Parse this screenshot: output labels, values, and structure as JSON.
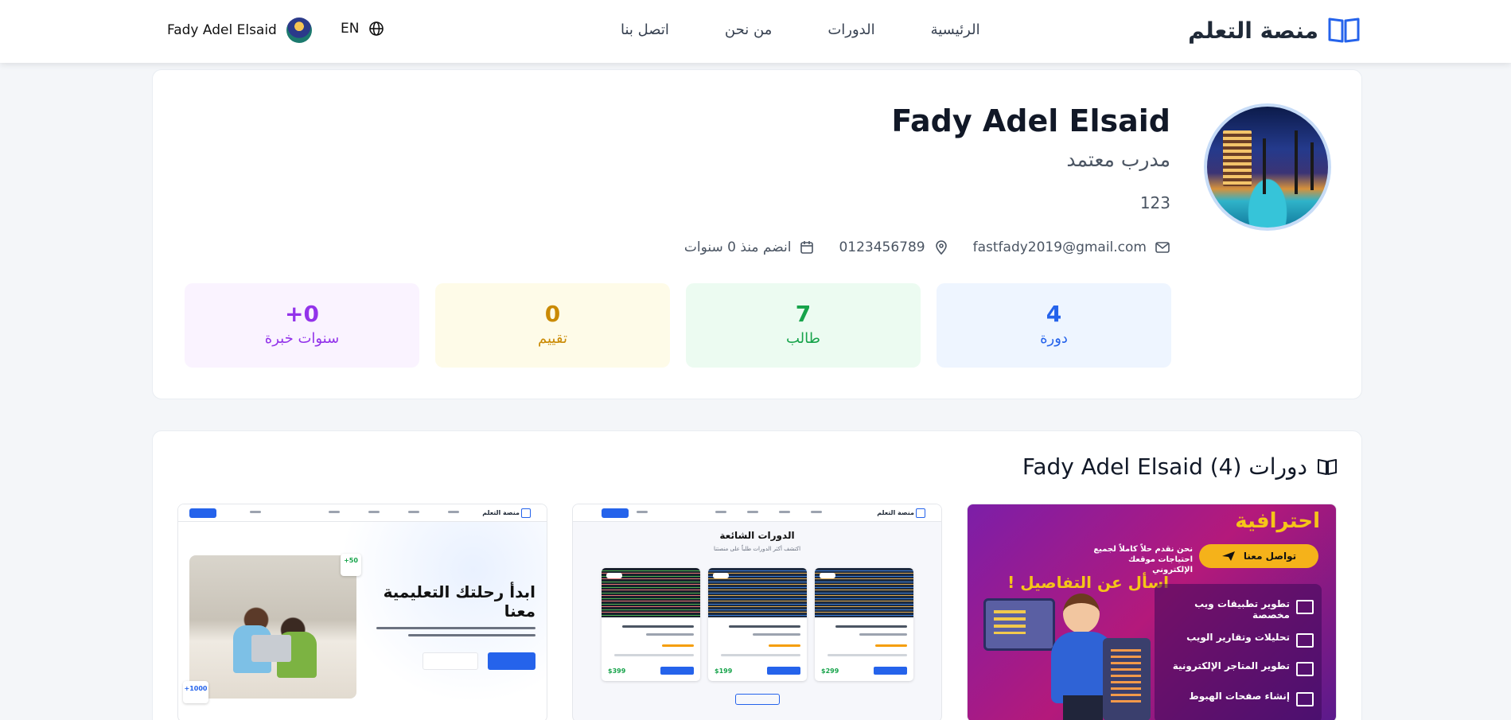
{
  "navbar": {
    "brand": "منصة التعلم",
    "links": [
      "الرئيسية",
      "الدورات",
      "من نحن",
      "اتصل بنا"
    ],
    "language": "EN",
    "user_name": "Fady Adel Elsaid"
  },
  "profile": {
    "name": "Fady Adel Elsaid",
    "title": "مدرب معتمد",
    "bio": "123",
    "email": "fastfady2019@gmail.com",
    "phone": "0123456789",
    "joined": "انضم منذ 0 سنوات",
    "stats": [
      {
        "value": "4",
        "label": "دورة",
        "color": "#2563eb"
      },
      {
        "value": "7",
        "label": "طالب",
        "color": "#16a34a"
      },
      {
        "value": "0",
        "label": "تقييم",
        "color": "#ca8a04"
      },
      {
        "value": "+0",
        "label": "سنوات خبرة",
        "color": "#9333ea"
      }
    ]
  },
  "courses_section": {
    "title": "دورات Fady Adel Elsaid (4)"
  },
  "thumbnails": {
    "promo": {
      "header": "احترافية",
      "button": "تواصل معنا",
      "button_text": "نحن نقدم حلاً كاملاً لجميع احتياجات موقعك الإلكتروني",
      "ask": "اسأل عن التفاصيل !",
      "items": [
        "تطوير تطبيقات ويب مخصصة",
        "تحليلات وتقارير الويب",
        "تطوير المتاجر الإلكترونية",
        "إنشاء صفحات الهبوط"
      ]
    },
    "popular": {
      "title": "الدورات الشائعة",
      "subtitle": "اكتشف أكثر الدورات طلباً على منصتنا",
      "prices": [
        "$299",
        "$199",
        "$399"
      ]
    },
    "hero": {
      "title": "ابدأ رحلتك التعليمية معنا",
      "badge_top": "+50",
      "badge_bottom": "+1000"
    }
  },
  "colors": {
    "primary": "#2563eb",
    "green": "#16a34a",
    "yellow": "#ca8a04",
    "purple": "#9333ea"
  }
}
